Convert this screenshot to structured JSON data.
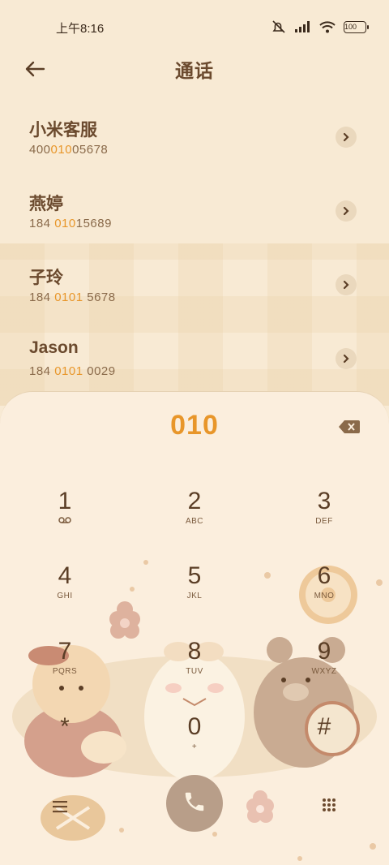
{
  "status": {
    "time": "上午8:16",
    "battery": "100"
  },
  "header": {
    "title": "通话"
  },
  "contacts": [
    {
      "name": "小米客服",
      "num_pre": "400",
      "num_hl": "010",
      "num_post": "05678"
    },
    {
      "name": "燕婷",
      "num_pre": "184 ",
      "num_hl": "010",
      "num_post": "15689"
    },
    {
      "name": "子玲",
      "num_pre": "184 ",
      "num_hl": "0101",
      "num_post": " 5678"
    },
    {
      "name": "Jason",
      "num_pre": "184 ",
      "num_hl": "0101",
      "num_post": " 0029"
    }
  ],
  "dialer": {
    "input": "010",
    "keys": [
      {
        "digit": "1",
        "letters": ""
      },
      {
        "digit": "2",
        "letters": "ABC"
      },
      {
        "digit": "3",
        "letters": "DEF"
      },
      {
        "digit": "4",
        "letters": "GHI"
      },
      {
        "digit": "5",
        "letters": "JKL"
      },
      {
        "digit": "6",
        "letters": "MNO"
      },
      {
        "digit": "7",
        "letters": "PQRS"
      },
      {
        "digit": "8",
        "letters": "TUV"
      },
      {
        "digit": "9",
        "letters": "WXYZ"
      },
      {
        "digit": "*",
        "letters": ""
      },
      {
        "digit": "0",
        "letters": "+"
      },
      {
        "digit": "#",
        "letters": ""
      }
    ]
  },
  "colors": {
    "accent": "#e8962a",
    "text": "#6b4a2e",
    "background": "#f8ead4",
    "call_button": "#b89e89"
  },
  "icons": [
    "back-arrow-icon",
    "mute-icon",
    "signal-icon",
    "wifi-icon",
    "battery-icon",
    "chevron-right-icon",
    "backspace-icon",
    "voicemail-icon",
    "menu-icon",
    "phone-icon",
    "dialpad-icon"
  ]
}
